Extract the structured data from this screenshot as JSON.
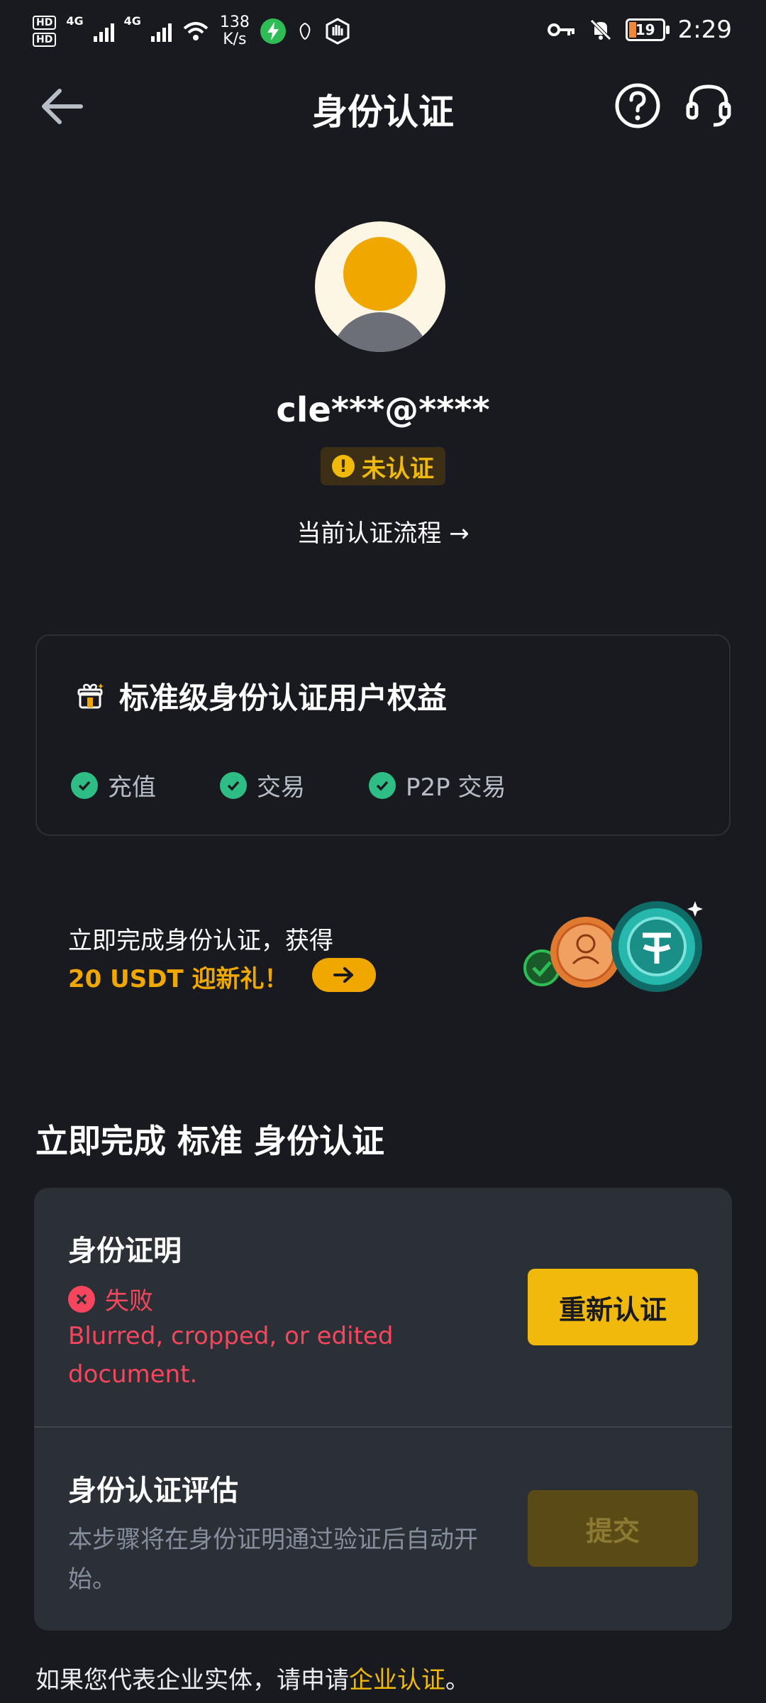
{
  "status_bar": {
    "hd1": "HD",
    "hd2": "HD",
    "net1": "4G",
    "net2": "4G",
    "speed_value": "138",
    "speed_unit": "K/s",
    "battery": "19",
    "time": "2:29"
  },
  "header": {
    "title": "身份认证"
  },
  "profile": {
    "username": "cle***@****",
    "status": "未认证",
    "flow_link": "当前认证流程 →"
  },
  "benefits": {
    "title": "标准级身份认证用户权益",
    "items": [
      {
        "label": "充值"
      },
      {
        "label": "交易"
      },
      {
        "label": "P2P 交易"
      }
    ]
  },
  "promo": {
    "line1": "立即完成身份认证，获得",
    "line2": "20 USDT 迎新礼！"
  },
  "section": {
    "title": "立即完成 标准 身份认证"
  },
  "steps": [
    {
      "title": "身份证明",
      "status": "失败",
      "reason": "Blurred, cropped, or edited document.",
      "button": "重新认证"
    },
    {
      "title": "身份认证评估",
      "desc": "本步骤将在身份证明通过验证后自动开始。",
      "button": "提交"
    }
  ],
  "enterprise": {
    "prefix": "如果您代表企业实体，请申请",
    "link": "企业认证",
    "suffix": "。"
  },
  "colors": {
    "background": "#181a20",
    "accent": "#f0b90b",
    "success": "#2ebd85",
    "error": "#f6465d"
  }
}
